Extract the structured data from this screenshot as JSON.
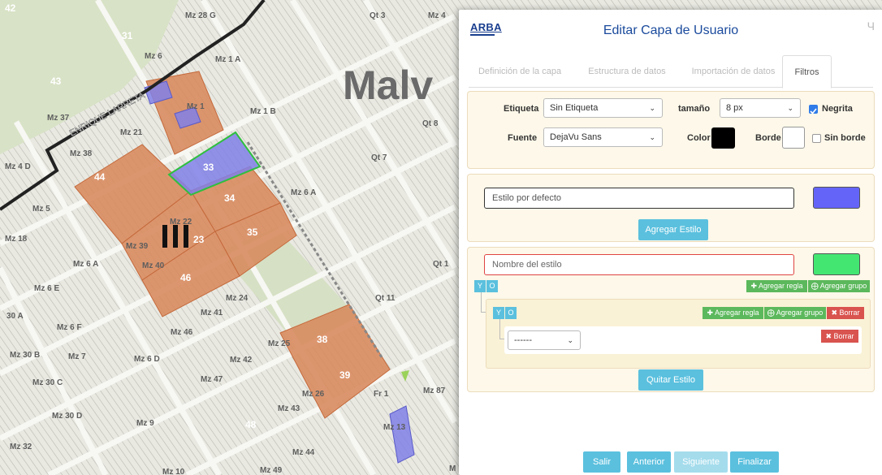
{
  "modal": {
    "logo_text": "ARBA",
    "title": "Editar Capa de Usuario",
    "close_glyph": "Ч"
  },
  "tabs": [
    {
      "label": "Definición de la capa",
      "active": false
    },
    {
      "label": "Estructura de datos",
      "active": false
    },
    {
      "label": "Importación de datos",
      "active": false
    },
    {
      "label": "Filtros",
      "active": true
    }
  ],
  "label_panel": {
    "etiqueta_label": "Etiqueta",
    "etiqueta_value": "Sin Etiqueta",
    "tamano_label": "tamaño",
    "tamano_value": "8 px",
    "negrita_label": "Negrita",
    "negrita_checked": true,
    "fuente_label": "Fuente",
    "fuente_value": "DejaVu Sans",
    "color_label": "Color",
    "color_value": "#000000",
    "borde_label": "Borde",
    "borde_value": "#ffffff",
    "sin_borde_label": "Sin borde",
    "sin_borde_checked": false
  },
  "default_style": {
    "name_value": "Estilo por defecto",
    "color": "#6464f8",
    "add_button": "Agregar Estilo"
  },
  "rule_style": {
    "name_placeholder": "Nombre del estilo",
    "color": "#44e672",
    "outer_y": "Y",
    "outer_o": "O",
    "outer_add_rule": "Agregar regla",
    "outer_add_group": "Agregar grupo",
    "inner_y": "Y",
    "inner_o": "O",
    "inner_add_rule": "Agregar regla",
    "inner_add_group": "Agregar grupo",
    "inner_delete": "Borrar",
    "field_select_value": "------",
    "rule_delete": "Borrar",
    "remove_button": "Quitar Estilo"
  },
  "footer": {
    "salir": "Salir",
    "anterior": "Anterior",
    "siguiente": "Siguiente",
    "finalizar": "Finalizar"
  },
  "map": {
    "city_label": "Malv",
    "street_name": "ENRIQUE LARRETA",
    "block_labels": [
      {
        "text": "Mz 28 G"
      },
      {
        "text": "Qt 3"
      },
      {
        "text": "Mz 4"
      },
      {
        "text": "31"
      },
      {
        "text": "Mz 6"
      },
      {
        "text": "Mz 1 A"
      },
      {
        "text": "43"
      },
      {
        "text": "Mz 37"
      },
      {
        "text": "Mz 21"
      },
      {
        "text": "Mz 1 B"
      },
      {
        "text": "Qt 8"
      },
      {
        "text": "Mz 38"
      },
      {
        "text": "Mz 4 D"
      },
      {
        "text": "Qt 7"
      },
      {
        "text": "44"
      },
      {
        "text": "33"
      },
      {
        "text": "Mz 6 A"
      },
      {
        "text": "34"
      },
      {
        "text": "Mz 5"
      },
      {
        "text": "Mz 22"
      },
      {
        "text": "Mz 18"
      },
      {
        "text": "Mz 39"
      },
      {
        "text": "23"
      },
      {
        "text": "35"
      },
      {
        "text": "Mz 6 A"
      },
      {
        "text": "Mz 40"
      },
      {
        "text": "Qt 1"
      },
      {
        "text": "46"
      },
      {
        "text": "Mz 6 E"
      },
      {
        "text": "Mz 24"
      },
      {
        "text": "Qt 11"
      },
      {
        "text": "30 A"
      },
      {
        "text": "Mz 41"
      },
      {
        "text": "Mz 6 F"
      },
      {
        "text": "Mz 46"
      },
      {
        "text": "Mz 30 B"
      },
      {
        "text": "Mz 7"
      },
      {
        "text": "Mz 6 D"
      },
      {
        "text": "Mz 25"
      },
      {
        "text": "38"
      },
      {
        "text": "Mz 42"
      },
      {
        "text": "Mz 47"
      },
      {
        "text": "Mz 30 C"
      },
      {
        "text": "39"
      },
      {
        "text": "Mz 26"
      },
      {
        "text": "Fr 1"
      },
      {
        "text": "Mz 87"
      },
      {
        "text": "Mz 43"
      },
      {
        "text": "Mz 30 D"
      },
      {
        "text": "Mz 9"
      },
      {
        "text": "48"
      },
      {
        "text": "Mz 13"
      },
      {
        "text": "Mz 32"
      },
      {
        "text": "Mz 44"
      },
      {
        "text": "Mz 10"
      },
      {
        "text": "Mz 49"
      },
      {
        "text": "42"
      },
      {
        "text": "Mz 1"
      },
      {
        "text": "M"
      }
    ]
  },
  "colors": {
    "accent_teal": "#5bc0de",
    "success_green": "#5cb85c",
    "danger_red": "#d9534f",
    "panel_bg": "#fdf8e9",
    "parcel_orange": "#d8895c",
    "parcel_blue": "#8080e8"
  }
}
